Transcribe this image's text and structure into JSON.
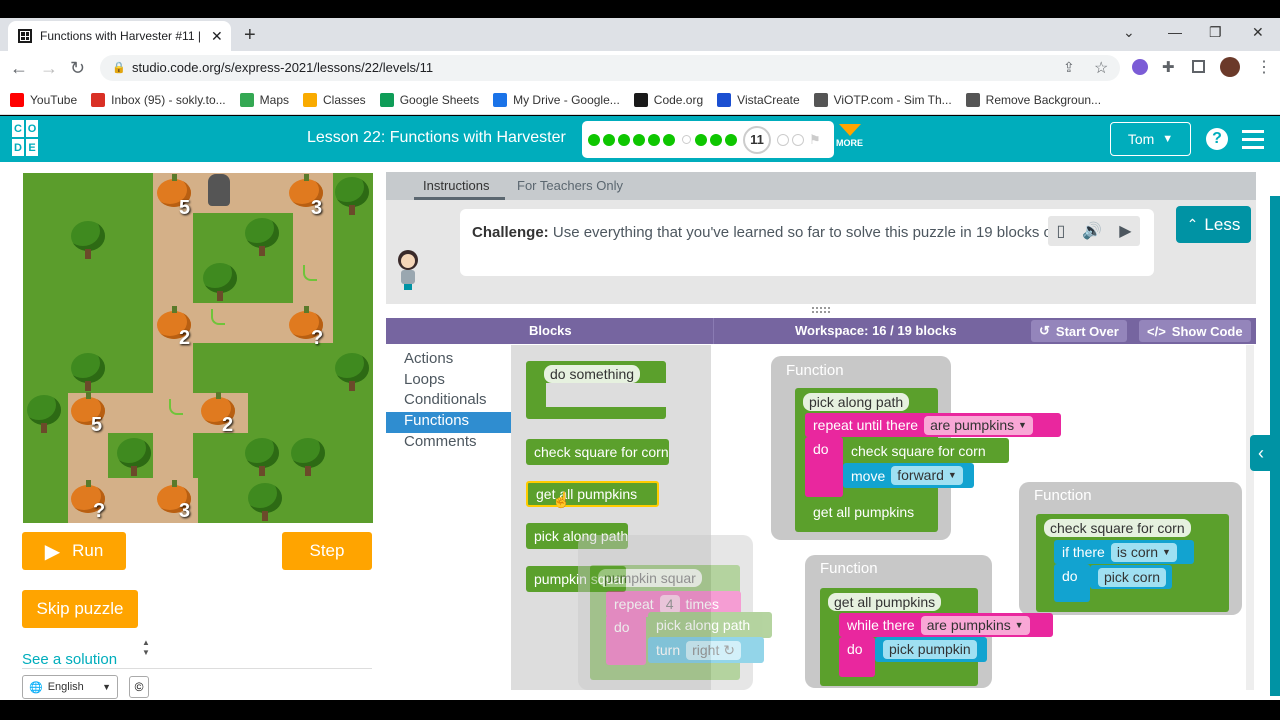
{
  "browser": {
    "tab_title": "Functions with Harvester #11 | Ex",
    "tab_close": "✕",
    "new_tab": "+",
    "url": "studio.code.org/s/express-2021/lessons/22/levels/11",
    "bookmarks": [
      {
        "label": "YouTube",
        "icon": "youtube-icon",
        "color": "#ff0000"
      },
      {
        "label": "Inbox (95) - sokly.to...",
        "icon": "gmail-icon",
        "color": "#d93025"
      },
      {
        "label": "Maps",
        "icon": "maps-icon",
        "color": "#34a853"
      },
      {
        "label": "Classes",
        "icon": "classroom-icon",
        "color": "#f9ab00"
      },
      {
        "label": "Google Sheets",
        "icon": "sheets-icon",
        "color": "#0f9d58"
      },
      {
        "label": "My Drive - Google...",
        "icon": "drive-icon",
        "color": "#1a73e8"
      },
      {
        "label": "Code.org",
        "icon": "codeorg-icon",
        "color": "#1a1a1a"
      },
      {
        "label": "VistaCreate",
        "icon": "vistacreate-icon",
        "color": "#1b4fd1"
      },
      {
        "label": "ViOTP.com - Sim Th...",
        "icon": "viotp-icon",
        "color": "#555555"
      },
      {
        "label": "Remove Backgroun...",
        "icon": "removebg-icon",
        "color": "#555555"
      }
    ]
  },
  "header": {
    "logo_letters": [
      "C",
      "O",
      "D",
      "E"
    ],
    "lesson_title": "Lesson 22: Functions with Harvester",
    "current_level": "11",
    "more_label": "MORE",
    "user_label": "Tom",
    "help_label": "?",
    "colors": {
      "teal": "#00adbc",
      "orange": "#ffa400",
      "green": "#0ec600"
    }
  },
  "progress": {
    "completed_before": 6,
    "assessment_after": 3,
    "remaining": 2
  },
  "maze": {
    "numbers": [
      "5",
      "3",
      "2",
      "?",
      "5",
      "2",
      "?",
      "3"
    ]
  },
  "controls": {
    "run_label": "Run",
    "step_label": "Step",
    "skip_label": "Skip puzzle",
    "see_solution": "See a solution",
    "language": "English",
    "cc_label": "©"
  },
  "instructions": {
    "tab_instructions": "Instructions",
    "tab_teachers": "For Teachers Only",
    "challenge_prefix": "Challenge:",
    "challenge_text": " Use everything that you've learned so far to solve this puzzle in 19 blocks or less!",
    "less_label": "Less"
  },
  "workspace": {
    "blocks_title": "Blocks",
    "workspace_title": "Workspace: 16 / 19 blocks",
    "start_over": "Start Over",
    "show_code": "Show Code",
    "categories": [
      "Actions",
      "Loops",
      "Conditionals",
      "Functions",
      "Comments"
    ],
    "selected_category": "Functions",
    "flyout_blocks": [
      "do something",
      "check square for corn",
      "get all pumpkins",
      "pick along path",
      "pumpkin squar"
    ],
    "function_label": "Function",
    "fn1": {
      "name": "pick along path",
      "repeat_until": "repeat until  there",
      "repeat_cond": "are pumpkins",
      "do": "do",
      "call1": "check square for corn",
      "move": "move",
      "move_dir": "forward",
      "call2": "get all pumpkins"
    },
    "fn2": {
      "name": "check square for corn",
      "if_there": "if  there",
      "if_cond": "is corn",
      "do": "do",
      "action": "pick corn"
    },
    "fn3": {
      "name": "get all pumpkins",
      "while_there": "while  there",
      "while_cond": "are pumpkins",
      "do": "do",
      "action": "pick pumpkin"
    },
    "ghost": {
      "name": "pumpkin squar",
      "repeat": "repeat",
      "times_value": "4",
      "times": "times",
      "do": "do",
      "call": "pick along path",
      "turn": "turn",
      "turn_dir": "right ↻"
    }
  }
}
